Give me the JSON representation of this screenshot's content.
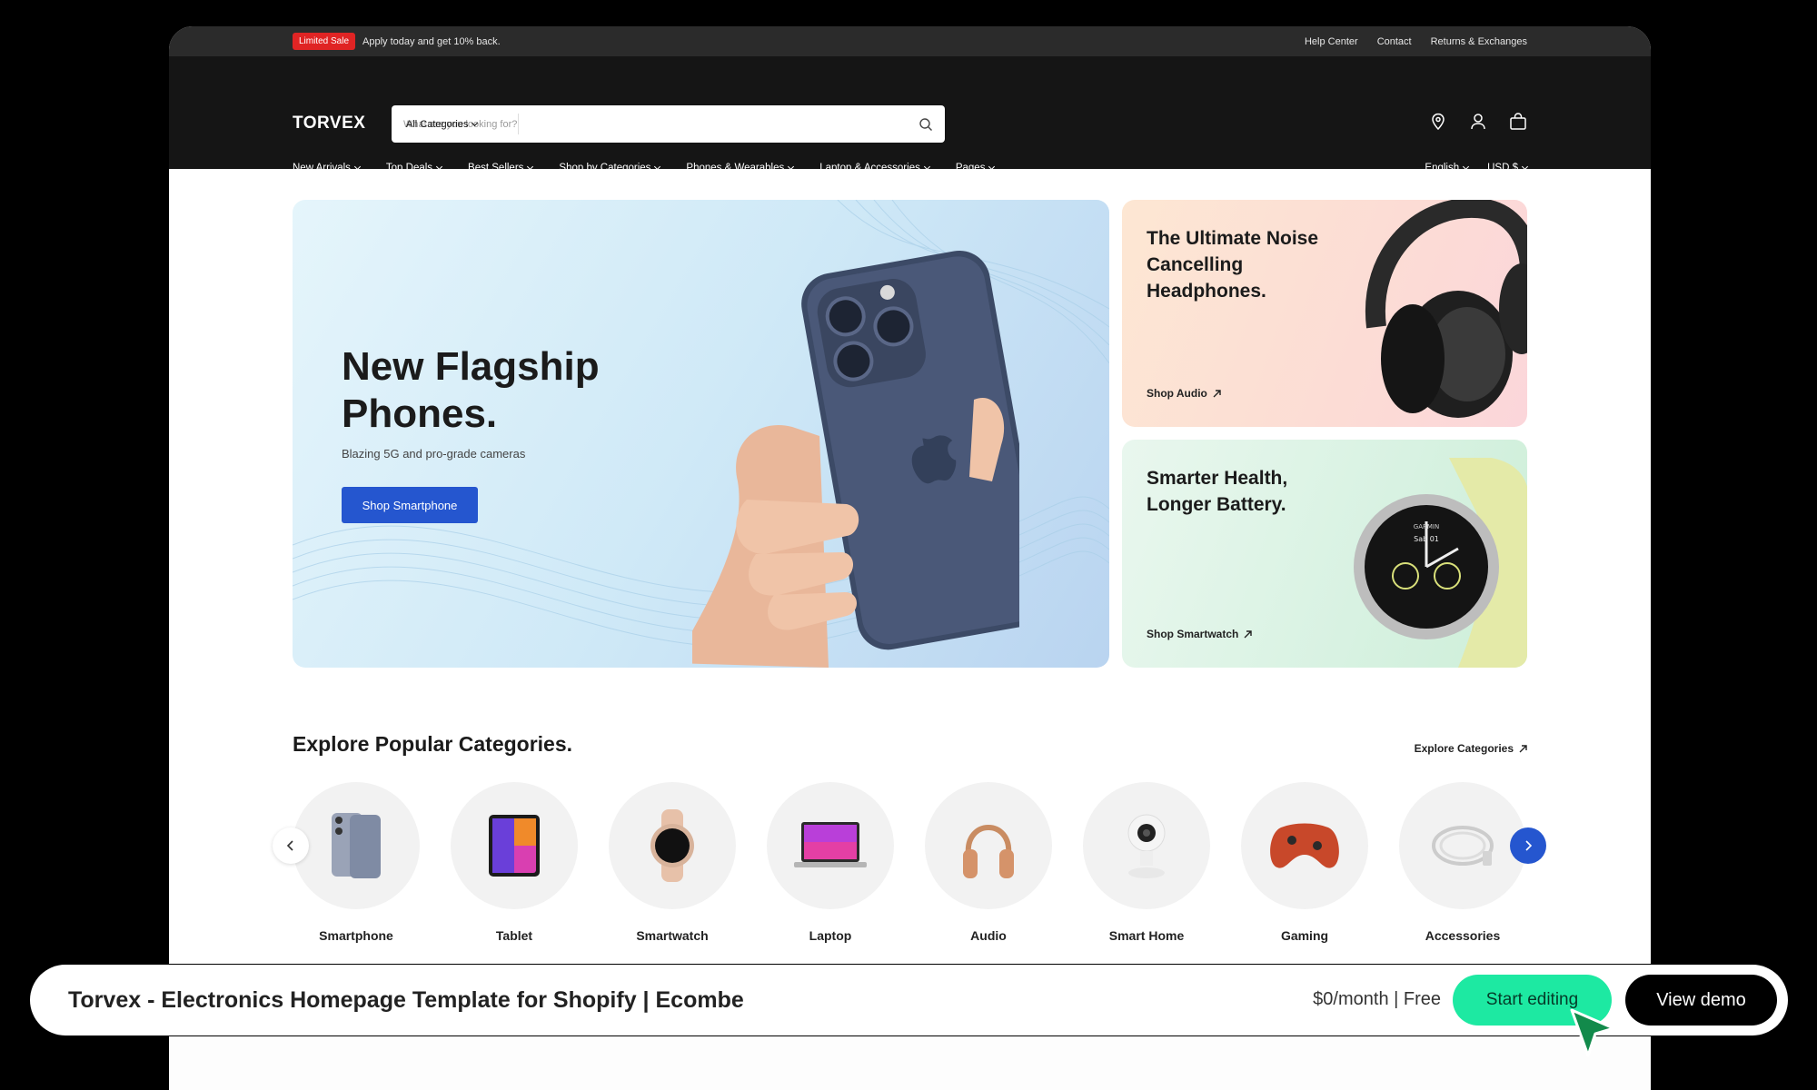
{
  "announcement": {
    "badge": "Limited Sale",
    "text": "Apply today and get 10% back.",
    "links": [
      "Help Center",
      "Contact",
      "Returns & Exchanges"
    ]
  },
  "header": {
    "logo": "TORVEX",
    "search": {
      "category": "All Categories",
      "placeholder": "What are you looking for?"
    },
    "icons": [
      "location-icon",
      "user-icon",
      "bag-icon"
    ]
  },
  "nav": {
    "items": [
      "New Arrivals",
      "Top Deals",
      "Best Sellers",
      "Shop by Categories",
      "Phones & Wearables",
      "Laptop & Accessories",
      "Pages"
    ],
    "language": "English",
    "currency": "USD $"
  },
  "hero": {
    "title_line1": "New Flagship",
    "title_line2": "Phones.",
    "subtitle": "Blazing 5G and pro-grade cameras",
    "button": "Shop Smartphone"
  },
  "promo_audio": {
    "title_line1": "The Ultimate Noise",
    "title_line2": "Cancelling",
    "title_line3": "Headphones.",
    "link": "Shop Audio"
  },
  "promo_watch": {
    "title_line1": "Smarter Health,",
    "title_line2": "Longer Battery.",
    "link": "Shop Smartwatch",
    "watch_brand": "GARMIN",
    "watch_date": "Sab 01"
  },
  "categories": {
    "title": "Explore Popular Categories.",
    "link": "Explore Categories",
    "items": [
      "Smartphone",
      "Tablet",
      "Smartwatch",
      "Laptop",
      "Audio",
      "Smart Home",
      "Gaming",
      "Accessories"
    ]
  },
  "bottom_bar": {
    "title": "Torvex - Electronics Homepage Template for Shopify | Ecombe",
    "price": "$0/month | Free",
    "edit_button": "Start editing",
    "demo_button": "View demo"
  },
  "colors": {
    "accent_blue": "#2556cf",
    "sale_red": "#e02424",
    "edit_green": "#1de9a2",
    "header_dark": "#151515"
  }
}
